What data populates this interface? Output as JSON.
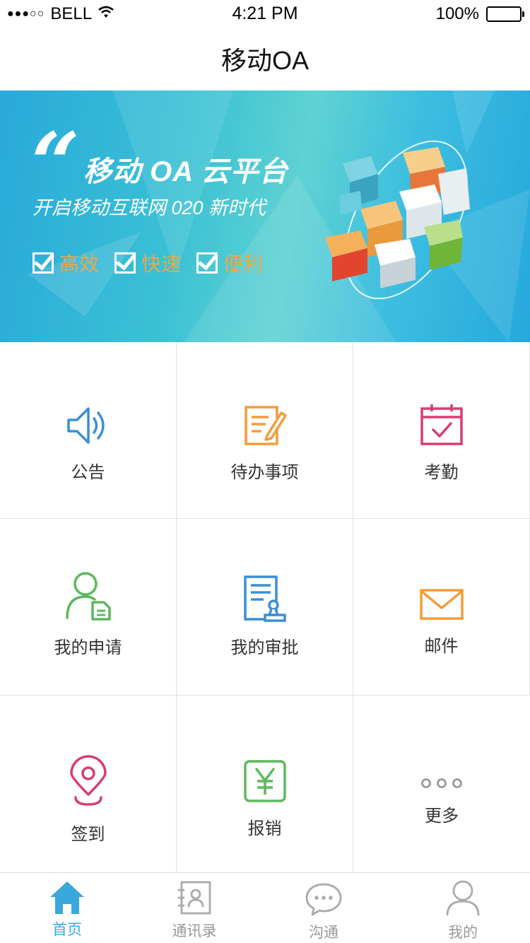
{
  "status_bar": {
    "signal": "●●●○○",
    "carrier": "BELL",
    "time": "4:21 PM",
    "battery": "100%"
  },
  "nav": {
    "title": "移动OA"
  },
  "banner": {
    "quote_mark": "“",
    "headline": "移动 OA 云平台",
    "subline": "开启移动互联网 020 新时代",
    "features": [
      "高效",
      "快速",
      "便利"
    ],
    "feature_color": "#f0a64a"
  },
  "grid": {
    "items": [
      {
        "label": "公告",
        "icon": "speaker-icon",
        "color": "#3b8fd6"
      },
      {
        "label": "待办事项",
        "icon": "note-pencil-icon",
        "color": "#f39c3a"
      },
      {
        "label": "考勤",
        "icon": "calendar-check-icon",
        "color": "#d63e6e"
      },
      {
        "label": "我的申请",
        "icon": "user-document-icon",
        "color": "#5cb85c"
      },
      {
        "label": "我的审批",
        "icon": "document-stamp-icon",
        "color": "#3b8fd6"
      },
      {
        "label": "邮件",
        "icon": "envelope-icon",
        "color": "#f39c3a"
      },
      {
        "label": "签到",
        "icon": "location-pin-icon",
        "color": "#d63e6e"
      },
      {
        "label": "报销",
        "icon": "yen-icon",
        "color": "#5cb85c"
      },
      {
        "label": "更多",
        "icon": "more-dots-icon",
        "color": "#999999"
      }
    ]
  },
  "tab_bar": {
    "tabs": [
      {
        "label": "首页",
        "icon": "home-icon",
        "active": true
      },
      {
        "label": "通讯录",
        "icon": "contacts-icon",
        "active": false
      },
      {
        "label": "沟通",
        "icon": "chat-bubble-icon",
        "active": false
      },
      {
        "label": "我的",
        "icon": "profile-icon",
        "active": false
      }
    ],
    "active_color": "#3aa8dc",
    "inactive_color": "#999999"
  }
}
